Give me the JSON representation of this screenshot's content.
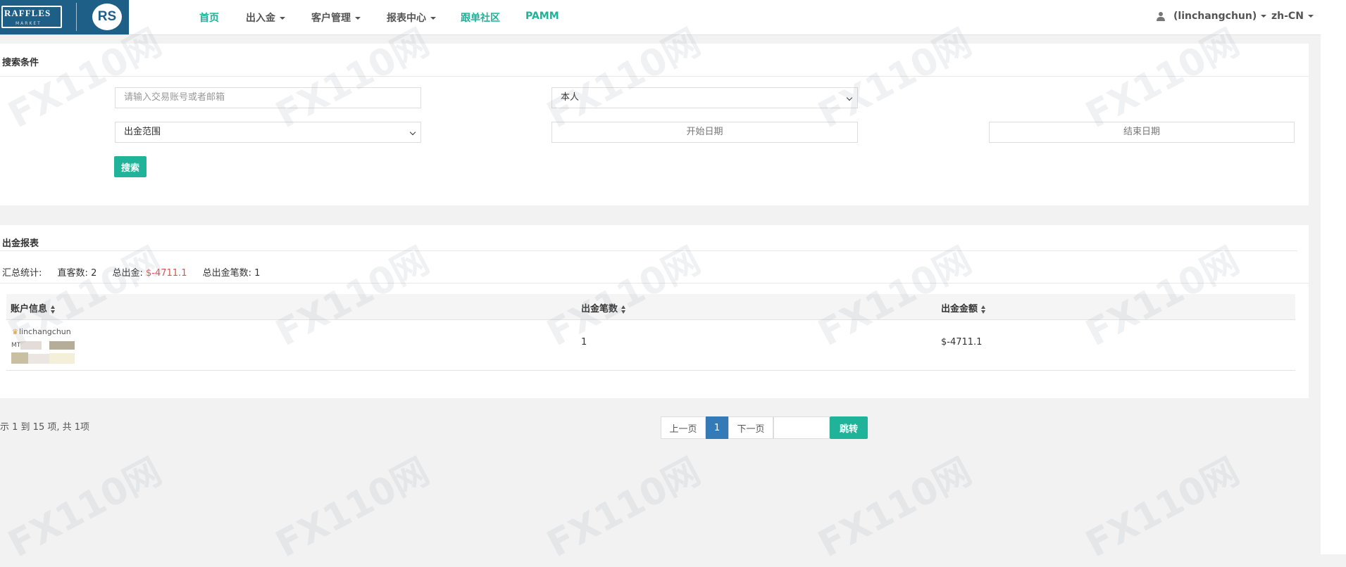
{
  "nav": {
    "logo_text": "RAFFLES",
    "logo_sub": "MARKET",
    "logo_rs": "RS",
    "items": [
      {
        "label": "首页"
      },
      {
        "label": "出入金"
      },
      {
        "label": "客户管理"
      },
      {
        "label": "报表中心"
      },
      {
        "label": "跟单社区"
      },
      {
        "label": "PAMM"
      }
    ],
    "user": "(linchangchun)",
    "lang": "zh-CN"
  },
  "search": {
    "title": "搜索条件",
    "account_placeholder": "请输入交易账号或者邮箱",
    "scope_value": "本人",
    "range_value": "出金范围",
    "start_date_placeholder": "开始日期",
    "end_date_placeholder": "结束日期",
    "search_button": "搜索"
  },
  "report": {
    "title": "出金报表",
    "summary_label": "汇总统计:",
    "direct_label": "直客数:",
    "direct_value": "2",
    "total_label": "总出金:",
    "total_value": "$-4711.1",
    "count_label": "总出金笔数:",
    "count_value": "1",
    "columns": [
      "账户信息",
      "出金笔数",
      "出金金额"
    ],
    "rows": [
      {
        "account": "linchangchun",
        "account_prefix": "MT",
        "count": "1",
        "amount": "$-4711.1"
      }
    ]
  },
  "pagination": {
    "info": "示 1 到 15 项, 共 1项",
    "prev": "上一页",
    "current": "1",
    "next": "下一页",
    "go": "跳转"
  },
  "colors": {
    "accent": "#1fb39a",
    "negative": "#d9534f",
    "page_active": "#337ab7",
    "logo_bg": "#1e5f88"
  },
  "watermark": "FX110网"
}
